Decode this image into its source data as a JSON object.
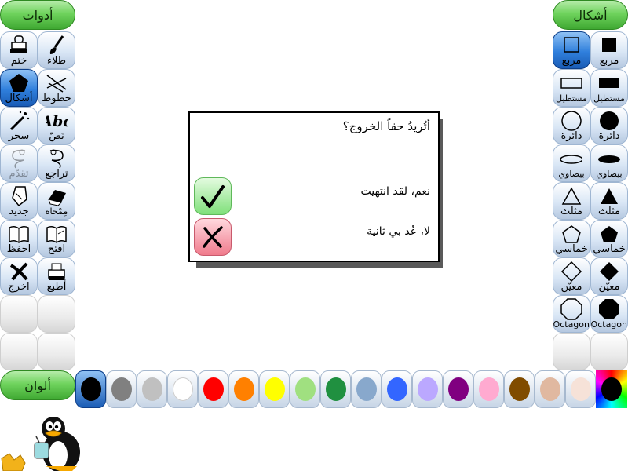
{
  "left_header": "أدوات",
  "right_header": "أشكال",
  "colors_header": "ألوان",
  "tools": [
    {
      "label": "طلاء",
      "icon": "paint-brush-icon",
      "selected": false,
      "disabled": false
    },
    {
      "label": "ختم",
      "icon": "stamp-icon",
      "selected": false,
      "disabled": false
    },
    {
      "label": "خطوط",
      "icon": "lines-icon",
      "selected": false,
      "disabled": false
    },
    {
      "label": "أشكال",
      "icon": "pentagon-icon",
      "selected": true,
      "disabled": false
    },
    {
      "label": "نَصّ",
      "icon": "text-icon",
      "selected": false,
      "disabled": false
    },
    {
      "label": "سحر",
      "icon": "magic-wand-icon",
      "selected": false,
      "disabled": false
    },
    {
      "label": "تراجع",
      "icon": "undo-icon",
      "selected": false,
      "disabled": false
    },
    {
      "label": "تقدّم",
      "icon": "redo-icon",
      "selected": false,
      "disabled": true
    },
    {
      "label": "مِمْحاة",
      "icon": "eraser-icon",
      "selected": false,
      "disabled": false
    },
    {
      "label": "جديد",
      "icon": "new-page-icon",
      "selected": false,
      "disabled": false
    },
    {
      "label": "افتح",
      "icon": "open-book-icon",
      "selected": false,
      "disabled": false
    },
    {
      "label": "احفظ",
      "icon": "save-book-icon",
      "selected": false,
      "disabled": false
    },
    {
      "label": "أطبع",
      "icon": "printer-icon",
      "selected": false,
      "disabled": false
    },
    {
      "label": "اخرج",
      "icon": "quit-icon",
      "selected": false,
      "disabled": false
    }
  ],
  "shapes": [
    {
      "label": "مربع",
      "icon": "square-filled-icon",
      "selected": false
    },
    {
      "label": "مربع",
      "icon": "square-outline-icon",
      "selected": true
    },
    {
      "label": "مستطيل",
      "icon": "rectangle-filled-icon",
      "selected": false
    },
    {
      "label": "مستطيل",
      "icon": "rectangle-outline-icon",
      "selected": false
    },
    {
      "label": "دائرة",
      "icon": "circle-filled-icon",
      "selected": false
    },
    {
      "label": "دائرة",
      "icon": "circle-outline-icon",
      "selected": false
    },
    {
      "label": "بيضاوي",
      "icon": "ellipse-filled-icon",
      "selected": false
    },
    {
      "label": "بيضاوي",
      "icon": "ellipse-outline-icon",
      "selected": false
    },
    {
      "label": "مثلث",
      "icon": "triangle-filled-icon",
      "selected": false
    },
    {
      "label": "مثلث",
      "icon": "triangle-outline-icon",
      "selected": false
    },
    {
      "label": "خماسي",
      "icon": "pentagon-filled-icon",
      "selected": false
    },
    {
      "label": "خماسي",
      "icon": "pentagon-outline-icon",
      "selected": false
    },
    {
      "label": "معيّن",
      "icon": "diamond-filled-icon",
      "selected": false
    },
    {
      "label": "معيّن",
      "icon": "diamond-outline-icon",
      "selected": false
    },
    {
      "label": "Octagon",
      "icon": "octagon-filled-icon",
      "selected": false
    },
    {
      "label": "Octagon",
      "icon": "octagon-outline-icon",
      "selected": false
    }
  ],
  "palette": [
    {
      "color": "#000000",
      "selected": true
    },
    {
      "color": "#808080",
      "selected": false
    },
    {
      "color": "#c0c0c0",
      "selected": false
    },
    {
      "color": "#ffffff",
      "selected": false
    },
    {
      "color": "#ff0000",
      "selected": false
    },
    {
      "color": "#ff8000",
      "selected": false
    },
    {
      "color": "#ffff00",
      "selected": false
    },
    {
      "color": "#a0e080",
      "selected": false
    },
    {
      "color": "#209040",
      "selected": false
    },
    {
      "color": "#88a8cc",
      "selected": false
    },
    {
      "color": "#3366ff",
      "selected": false
    },
    {
      "color": "#bba8ff",
      "selected": false
    },
    {
      "color": "#800080",
      "selected": false
    },
    {
      "color": "#ffaad0",
      "selected": false
    },
    {
      "color": "#804c00",
      "selected": false
    },
    {
      "color": "#e0b8a0",
      "selected": false
    },
    {
      "color": "#f6e2d8",
      "selected": false
    }
  ],
  "dialog": {
    "question": "أتُريدُ حقاً الخروج؟",
    "yes_label": "نعم، لقد انتهيت",
    "no_label": "لا، عُد بي ثانية"
  },
  "accent": "#2f7fdc"
}
